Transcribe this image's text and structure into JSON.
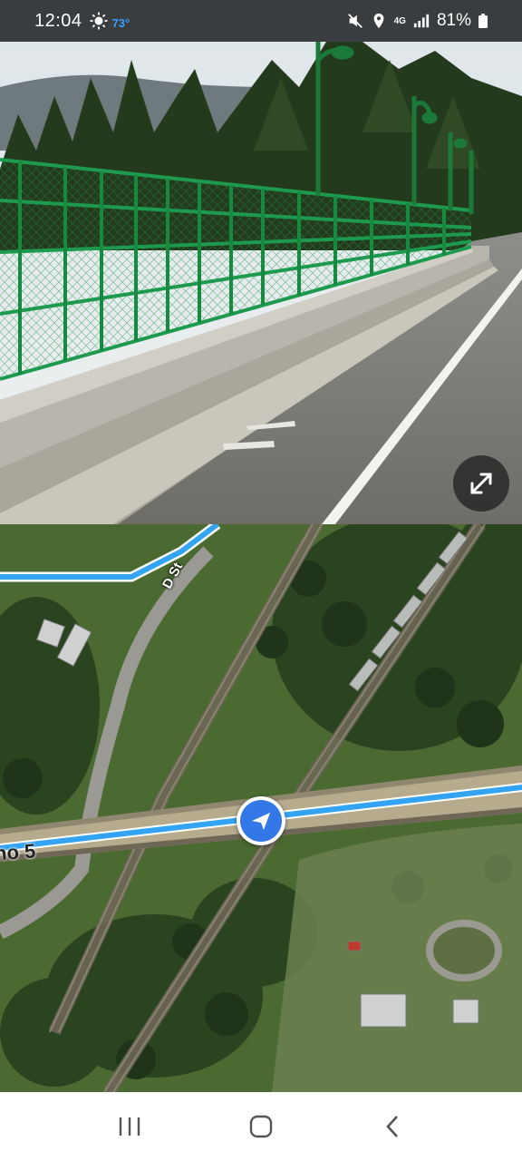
{
  "status_bar": {
    "time": "12:04",
    "weather_icon": "sun-icon",
    "temperature": "73°",
    "network": "4G",
    "battery": "81%",
    "icons": [
      "mute-icon",
      "location-icon",
      "network-icon",
      "signal-icon",
      "battery-icon"
    ]
  },
  "street_view": {
    "expand_icon": "expand-icon"
  },
  "map": {
    "street_label": "D St",
    "route_label": "no 5",
    "route_color": "#33a3f4",
    "marker_color": "#3477e6"
  },
  "nav_bar": {
    "buttons": [
      "recents-button",
      "home-button",
      "back-button"
    ]
  }
}
